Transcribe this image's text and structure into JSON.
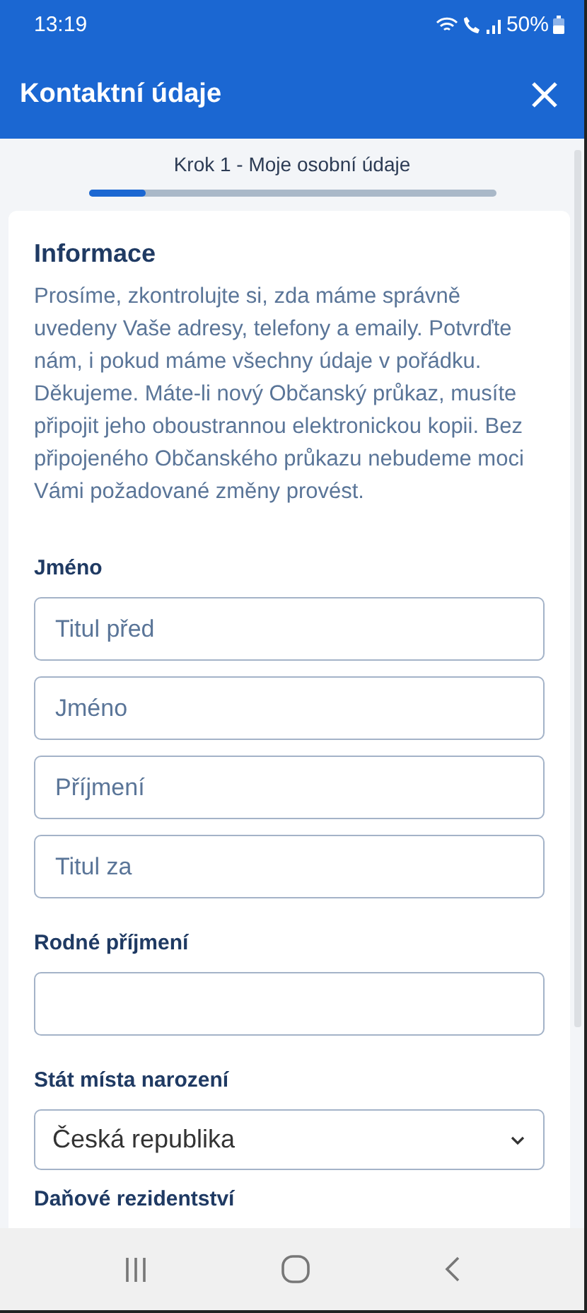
{
  "status_bar": {
    "time": "13:19",
    "battery": "50%"
  },
  "app_bar": {
    "title": "Kontaktní údaje"
  },
  "step": {
    "label": "Krok 1 - Moje osobní údaje",
    "level": 0.14
  },
  "info": {
    "title": "Informace",
    "text": "Prosíme, zkontrolujte si, zda máme správně uvedeny Vaše adresy, telefony a emaily. Potvrďte nám, i pokud máme všechny údaje v pořádku. Děkujeme. Máte-li nový Občanský průkaz, musíte připojit jeho oboustrannou elektronickou kopii. Bez připojeného Občanského průkazu nebudeme moci Vámi požadované změny provést."
  },
  "sections": [
    {
      "label": "Jméno",
      "fields": [
        {
          "kind": "input",
          "placeholder": "Titul před"
        },
        {
          "kind": "input",
          "placeholder": "Jméno"
        },
        {
          "kind": "input",
          "placeholder": "Příjmení"
        },
        {
          "kind": "input",
          "placeholder": "Titul za"
        }
      ]
    },
    {
      "label": "Rodné příjmení",
      "fields": [
        {
          "kind": "input"
        }
      ]
    },
    {
      "label": "Stát místa narození",
      "fields": [
        {
          "kind": "select",
          "value": "Česká republika"
        }
      ]
    },
    {
      "label": "Daňové rezidentství"
    }
  ]
}
